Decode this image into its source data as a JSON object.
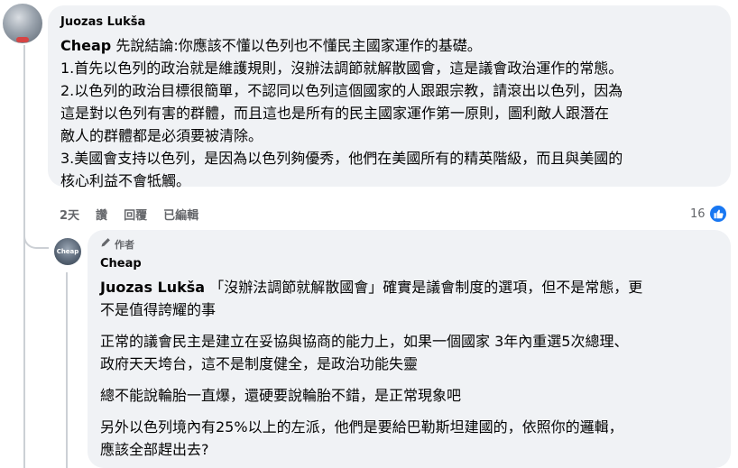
{
  "comment": {
    "author": "Juozas Lukša",
    "lines": [
      {
        "mention": "Cheap",
        "text": " 先說結論:你應該不懂以色列也不懂民主國家運作的基礎。"
      },
      {
        "mention": "",
        "text": "1.首先以色列的政治就是維護規則，沒辦法調節就解散國會，這是議會政治運作的常態。"
      },
      {
        "mention": "",
        "text": "2.以色列的政治目標很簡單，不認同以色列這個國家的人跟跟宗教，請滾出以色列，因為"
      },
      {
        "mention": "",
        "text": "這是對以色列有害的群體，而且這也是所有的民主國家運作第一原則，圖利敵人跟潛在"
      },
      {
        "mention": "",
        "text": "敵人的群體都是必須要被清除。"
      },
      {
        "mention": "",
        "text": "3.美國會支持以色列，是因為以色列夠優秀，他們在美國所有的精英階級，而且與美國的"
      },
      {
        "mention": "",
        "text": "核心利益不會牴觸。"
      }
    ],
    "time": "2天",
    "like_label": "讚",
    "reply_label": "回覆",
    "edited_label": "已編輯",
    "reaction_count": "16",
    "like_color": "#1877f2"
  },
  "reply": {
    "author_badge": "作者",
    "author": "Cheap",
    "avatar_text": "Cheap",
    "paragraphs": [
      [
        {
          "mention": "Juozas Lukša",
          "text": "「沒辦法調節就解散國會」確實是議會制度的選項，但不是常態，更"
        },
        {
          "mention": "",
          "text": "不是值得誇耀的事"
        }
      ],
      [
        {
          "mention": "",
          "text": "正常的議會民主是建立在妥協與協商的能力上，如果一個國家 3年內重選5次總理、"
        },
        {
          "mention": "",
          "text": "政府天天垮台，這不是制度健全，是政治功能失靈"
        }
      ],
      [
        {
          "mention": "",
          "text": "總不能說輪胎一直爆，還硬要說輪胎不錯，是正常現象吧"
        }
      ],
      [
        {
          "mention": "",
          "text": "另外以色列境內有25%以上的左派，他們是要給巴勒斯坦建國的，依照你的邏輯，"
        },
        {
          "mention": "",
          "text": "應該全部趕出去?"
        }
      ]
    ]
  },
  "icons": {
    "like": "thumbs-up-icon",
    "author_badge": "pen-icon"
  }
}
